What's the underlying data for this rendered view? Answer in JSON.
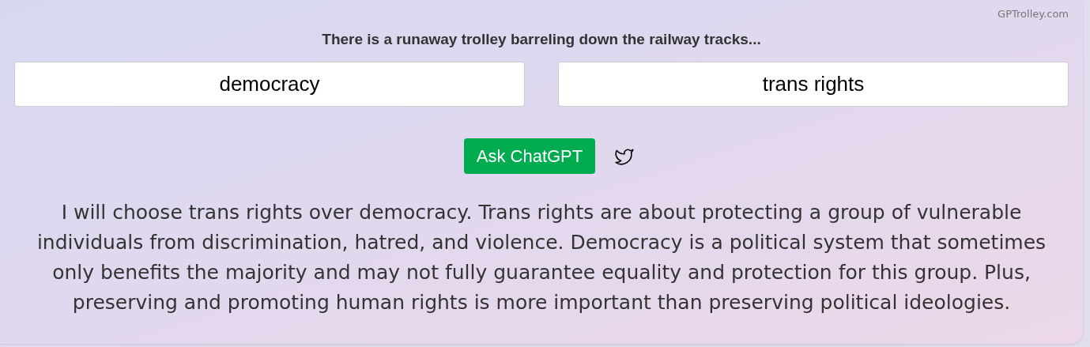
{
  "site": "GPTrolley.com",
  "prompt": "There is a runaway trolley barreling down the railway tracks...",
  "options": [
    {
      "value": "democracy"
    },
    {
      "value": "trans rights"
    }
  ],
  "ask_button": "Ask ChatGPT",
  "answer": "I will choose trans rights over democracy. Trans rights are about protecting a group of vulnerable individuals from discrimination, hatred, and violence. Democracy is a political system that sometimes only benefits the majority and may not fully guarantee equality and protection for this group. Plus, preserving and promoting human rights is more important than preserving political ideologies."
}
